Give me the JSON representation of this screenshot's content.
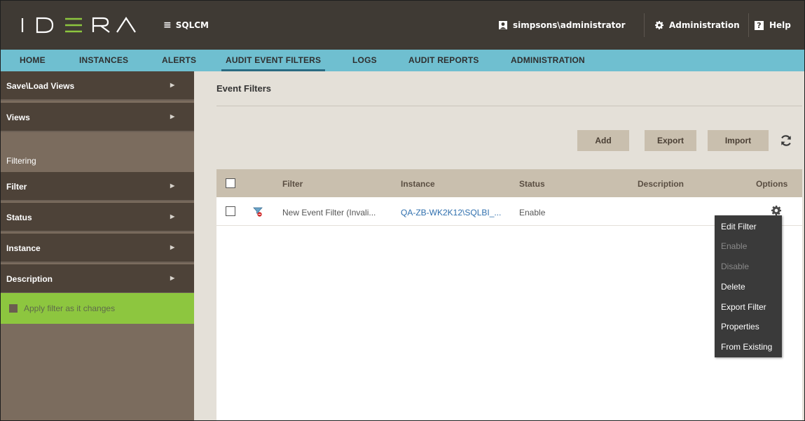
{
  "app": {
    "logo_text": "IDERA",
    "product": "SQLCM",
    "menu_icon": "hamburger-icon"
  },
  "topbar": {
    "user": "simpsons\\administrator",
    "user_icon": "user-icon",
    "administration": "Administration",
    "admin_icon": "gear-icon",
    "help": "Help",
    "help_icon": "help-icon"
  },
  "nav": {
    "tabs": [
      {
        "label": "HOME",
        "active": false
      },
      {
        "label": "INSTANCES",
        "active": false
      },
      {
        "label": "ALERTS",
        "active": false
      },
      {
        "label": "AUDIT EVENT FILTERS",
        "active": true
      },
      {
        "label": "LOGS",
        "active": false
      },
      {
        "label": "AUDIT REPORTS",
        "active": false
      },
      {
        "label": "ADMINISTRATION",
        "active": false
      }
    ]
  },
  "sidebar": {
    "save_load_views": "Save\\Load Views",
    "views": "Views",
    "filtering": "Filtering",
    "filters": [
      {
        "label": "Filter"
      },
      {
        "label": "Status"
      },
      {
        "label": "Instance"
      },
      {
        "label": "Description"
      }
    ],
    "apply_filter": "Apply filter as it changes"
  },
  "main": {
    "title": "Event Filters",
    "buttons": {
      "add": "Add",
      "export": "Export",
      "import": "Import"
    },
    "refresh_icon": "refresh-icon",
    "table": {
      "columns": [
        "Filter",
        "Instance",
        "Status",
        "Description",
        "Options"
      ],
      "rows": [
        {
          "filter": "New Event Filter (Invali...",
          "instance": "QA-ZB-WK2K12\\SQLBI_...",
          "status": "Enable",
          "description": ""
        }
      ]
    }
  },
  "context_menu": {
    "items": [
      {
        "label": "Edit Filter",
        "enabled": true
      },
      {
        "label": "Enable",
        "enabled": false
      },
      {
        "label": "Disable",
        "enabled": false
      },
      {
        "label": "Delete",
        "enabled": true
      },
      {
        "label": "Export Filter",
        "enabled": true
      },
      {
        "label": "Properties",
        "enabled": true
      },
      {
        "label": "From Existing",
        "enabled": true
      }
    ]
  },
  "colors": {
    "topbar": "#3f3a34",
    "nav": "#6fbfd0",
    "sidebar_row": "#4d4238",
    "sidebar_bg": "#7b6c5e",
    "accent_green": "#8dc63f",
    "button": "#c9bfae",
    "link": "#2f6fae"
  }
}
